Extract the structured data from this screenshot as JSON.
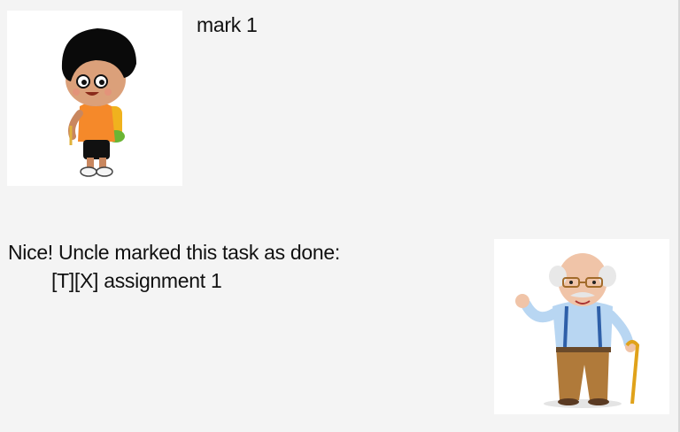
{
  "dialog": {
    "user_message": {
      "text": "mark 1",
      "avatar_icon": "boy-with-backpack-avatar"
    },
    "bot_message": {
      "line1": "Nice! Uncle marked this task as done:",
      "line2": "[T][X] assignment 1",
      "avatar_icon": "old-man-with-cane-avatar"
    }
  }
}
